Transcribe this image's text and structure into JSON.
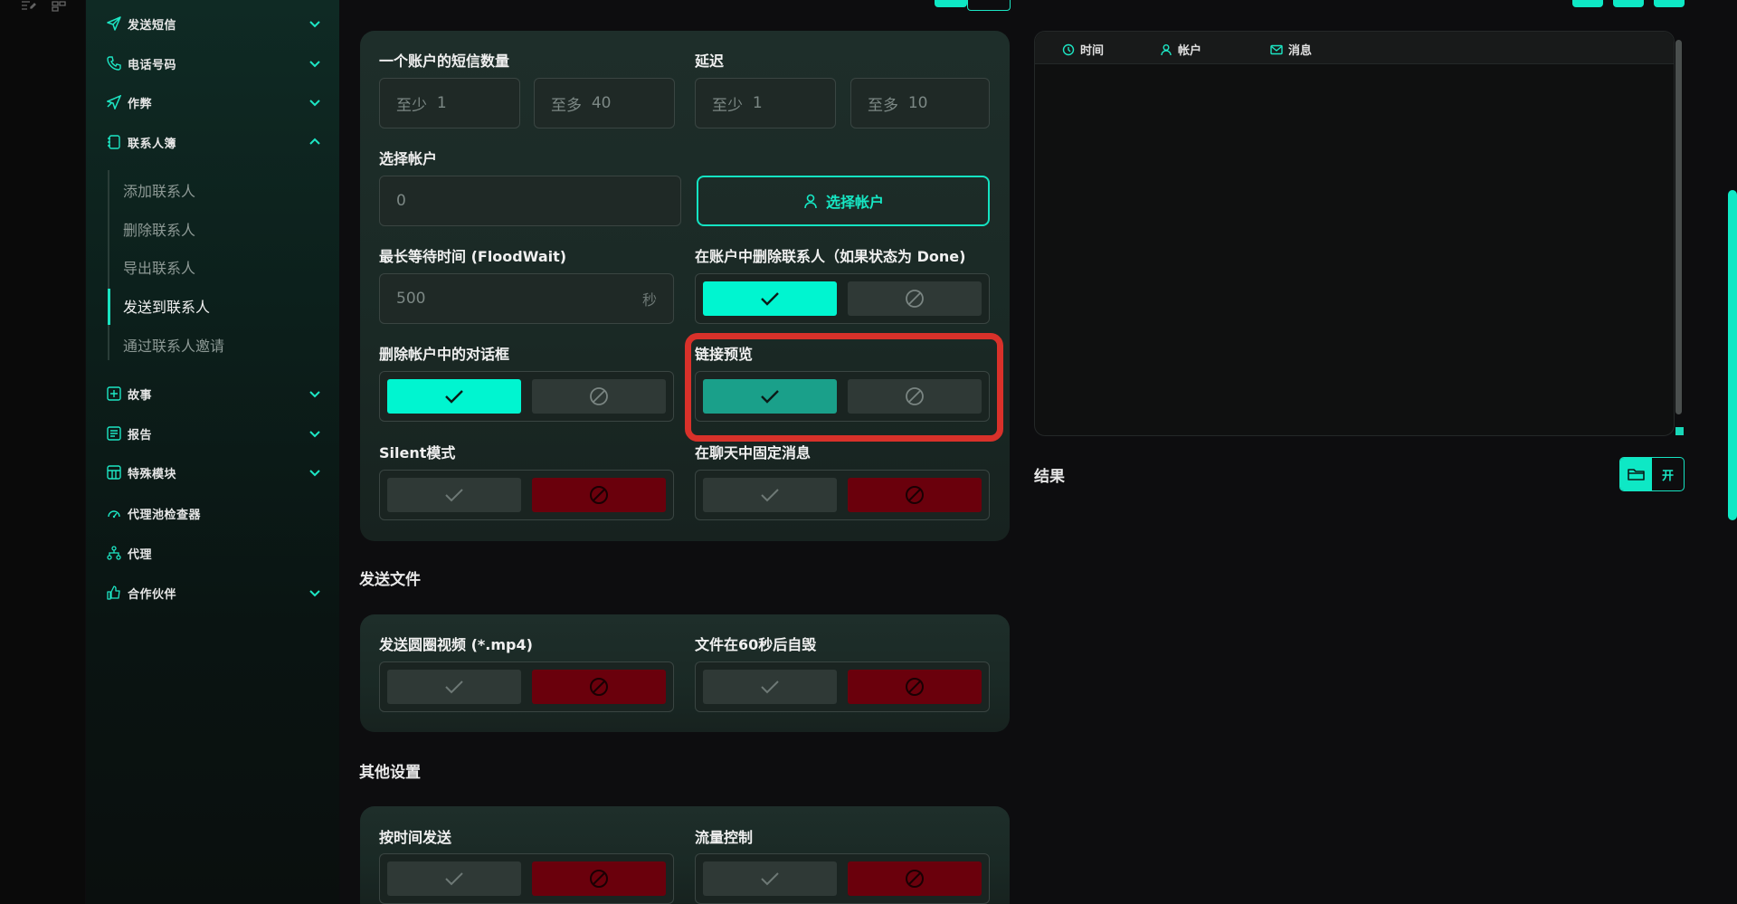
{
  "sidebar": {
    "items": [
      {
        "label": "发送短信",
        "icon": "send-icon"
      },
      {
        "label": "电话号码",
        "icon": "phone-icon"
      },
      {
        "label": "作弊",
        "icon": "paper-plane-cheat-icon"
      },
      {
        "label": "联系人簿",
        "icon": "contacts-book-icon"
      },
      {
        "label": "故事",
        "icon": "plus-square-icon"
      },
      {
        "label": "报告",
        "icon": "report-icon"
      },
      {
        "label": "特殊模块",
        "icon": "module-grid-icon"
      },
      {
        "label": "代理池检查器",
        "icon": "gauge-icon"
      },
      {
        "label": "代理",
        "icon": "network-icon"
      },
      {
        "label": "合作伙伴",
        "icon": "thumbs-up-icon"
      }
    ],
    "sub_items": [
      "添加联系人",
      "删除联系人",
      "导出联系人",
      "发送到联系人",
      "通过联系人邀请"
    ],
    "active_sub": "发送到联系人"
  },
  "settings": {
    "sms_per_account": {
      "label": "一个账户的短信数量",
      "min_placeholder": "至少",
      "min_value": "1",
      "max_placeholder": "至多",
      "max_value": "40"
    },
    "delay": {
      "label": "延迟",
      "min_placeholder": "至少",
      "min_value": "1",
      "max_placeholder": "至多",
      "max_value": "10"
    },
    "select_account": {
      "label": "选择帐户",
      "value": "0",
      "button_label": "选择帐户"
    },
    "max_wait": {
      "label": "最长等待时间 (FloodWait)",
      "value": "500",
      "unit": "秒"
    },
    "delete_contacts": {
      "label": "在账户中删除联系人（如果状态为 Done)",
      "enabled": true
    },
    "delete_dialogs": {
      "label": "删除帐户中的对话框",
      "enabled": true
    },
    "link_preview": {
      "label": "链接预览",
      "enabled": true
    },
    "silent_mode": {
      "label": "Silent模式",
      "enabled": false
    },
    "pin_message": {
      "label": "在聊天中固定消息",
      "enabled": false
    }
  },
  "send_files": {
    "title": "发送文件",
    "circle_video": {
      "label": "发送圆圈视频 (*.mp4)",
      "enabled": false
    },
    "self_destruct": {
      "label": "文件在60秒后自毁",
      "enabled": false
    }
  },
  "other_settings": {
    "title": "其他设置",
    "schedule": {
      "label": "按时间发送",
      "enabled": false
    },
    "flow_control": {
      "label": "流量控制",
      "enabled": false
    }
  },
  "log": {
    "columns": [
      {
        "label": "时间",
        "icon": "clock-icon"
      },
      {
        "label": "帐户",
        "icon": "user-icon"
      },
      {
        "label": "消息",
        "icon": "mail-icon"
      }
    ]
  },
  "results": {
    "label": "结果",
    "open_label": "开"
  },
  "colors": {
    "accent": "#00f5d0",
    "danger": "#6a000c",
    "highlight": "#d8312a"
  }
}
